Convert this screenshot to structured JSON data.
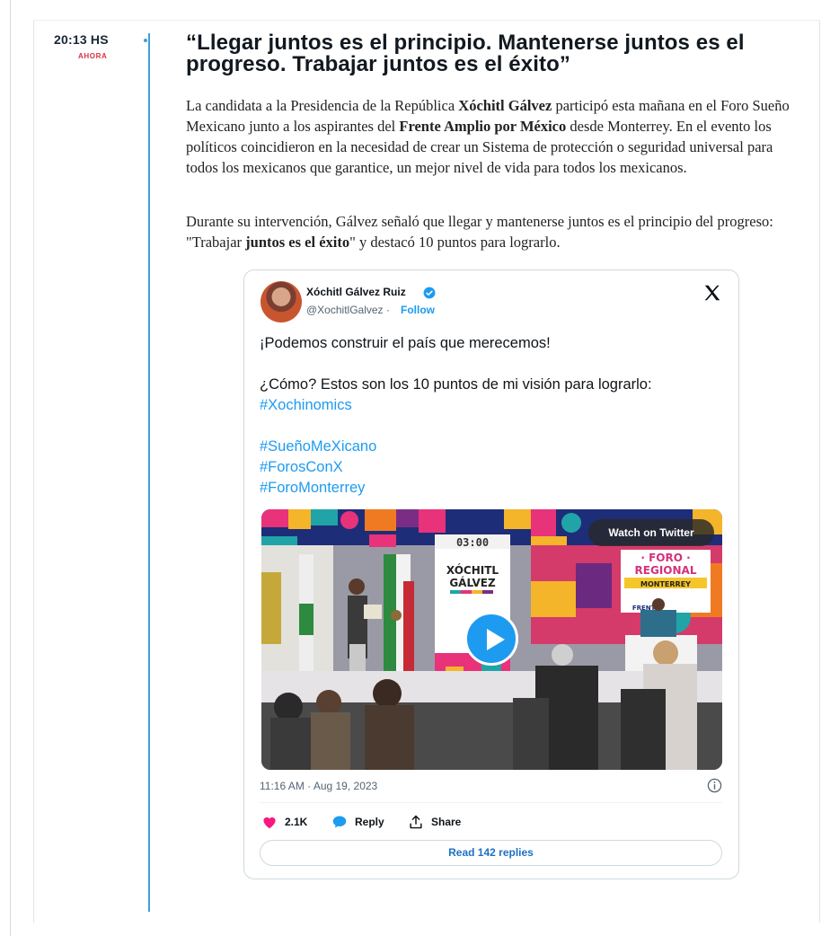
{
  "entry": {
    "time": "20:13 HS",
    "label": "AHORA",
    "headline": "“Llegar juntos es el principio. Mantenerse juntos es el progreso. Trabajar juntos es el éxito”",
    "paragraph1": {
      "a": "La candidata a la Presidencia de la República ",
      "b": "Xóchitl Gálvez",
      "c": " participó esta mañana en el Foro Sueño Mexicano junto a los aspirantes del ",
      "d": "Frente Amplio por México",
      "e": " desde Monterrey. En el evento los políticos coincidieron en la necesidad de crear un Sistema de protección o seguridad universal para todos los mexicanos que garantice, un mejor nivel de vida para todos los mexicanos."
    },
    "paragraph2": {
      "a": "Durante su intervención, Gálvez señaló que llegar y mantenerse juntos es el principio del progreso: \"Trabajar ",
      "b": "juntos es el éxito",
      "c": "\" y destacó 10 puntos para lograrlo."
    }
  },
  "tweet": {
    "author": "Xóchitl Gálvez Ruiz",
    "handle": "@XochitlGalvez",
    "separator": "·",
    "follow": "Follow",
    "text_line1": "¡Podemos construir el país que merecemos!",
    "text_line2": "¿Cómo? Estos son los 10 puntos de mi visión para lograrlo:",
    "hashtags": [
      "#Xochinomics",
      "#SueñoMeXicano",
      "#ForosConX",
      "#ForoMonterrey"
    ],
    "video": {
      "watch_label": "Watch on Twitter",
      "timer": "03:00",
      "podium_name_1": "XÓCHITL",
      "podium_name_2": "GÁLVEZ",
      "sign_line1": "· FORO ·",
      "sign_line2": "REGIONAL",
      "sign_line3": "MONTERREY",
      "sign_line4": "FRENTE"
    },
    "date": "11:16 AM · Aug 19, 2023",
    "likes": "2.1K",
    "reply": "Reply",
    "share": "Share",
    "read_replies": "Read 142 replies"
  },
  "colors": {
    "accent": "#3f9fd8",
    "label_red": "#d9333f",
    "link_blue": "#1d9bf0",
    "like_pink": "#f91880"
  }
}
